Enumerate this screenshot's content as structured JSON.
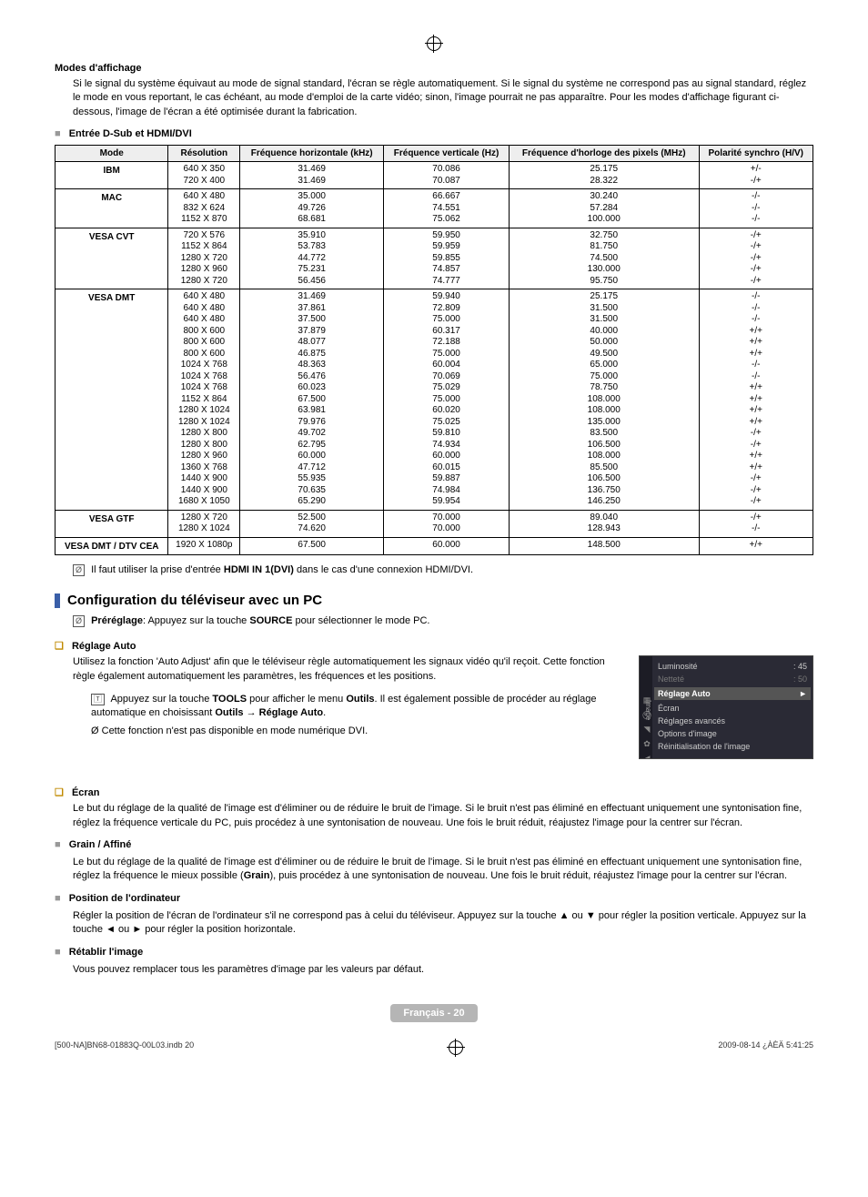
{
  "top": {
    "title": "Modes d'affichage",
    "intro": "Si le signal du système équivaut au mode de signal standard, l'écran se règle automatiquement. Si le signal du système ne correspond pas au signal standard, réglez le mode en vous reportant, le cas échéant, au mode d'emploi de la carte vidéo; sinon, l'image pourrait ne pas apparaître. Pour les modes d'affichage figurant ci-dessous, l'image de l'écran a été optimisée durant la fabrication.",
    "subheading": "Entrée D-Sub et HDMI/DVI"
  },
  "table": {
    "headers": {
      "mode": "Mode",
      "res": "Résolution",
      "hfreq": "Fréquence horizontale (kHz)",
      "vfreq": "Fréquence verticale (Hz)",
      "pfreq": "Fréquence d'horloge des pixels (MHz)",
      "pol": "Polarité synchro (H/V)"
    },
    "rows": [
      {
        "mode": "IBM",
        "res": [
          "640 X 350",
          "720 X 400"
        ],
        "h": [
          "31.469",
          "31.469"
        ],
        "v": [
          "70.086",
          "70.087"
        ],
        "p": [
          "25.175",
          "28.322"
        ],
        "pol": [
          "+/-",
          "-/+"
        ]
      },
      {
        "mode": "MAC",
        "res": [
          "640 X 480",
          "832 X 624",
          "1152 X 870"
        ],
        "h": [
          "35.000",
          "49.726",
          "68.681"
        ],
        "v": [
          "66.667",
          "74.551",
          "75.062"
        ],
        "p": [
          "30.240",
          "57.284",
          "100.000"
        ],
        "pol": [
          "-/-",
          "-/-",
          "-/-"
        ]
      },
      {
        "mode": "VESA CVT",
        "res": [
          "720 X 576",
          "1152 X 864",
          "1280 X 720",
          "1280 X 960",
          "1280 X 720"
        ],
        "h": [
          "35.910",
          "53.783",
          "44.772",
          "75.231",
          "56.456"
        ],
        "v": [
          "59.950",
          "59.959",
          "59.855",
          "74.857",
          "74.777"
        ],
        "p": [
          "32.750",
          "81.750",
          "74.500",
          "130.000",
          "95.750"
        ],
        "pol": [
          "-/+",
          "-/+",
          "-/+",
          "-/+",
          "-/+"
        ]
      },
      {
        "mode": "VESA DMT",
        "res": [
          "640 X 480",
          "640 X 480",
          "640 X 480",
          "800 X 600",
          "800 X 600",
          "800 X 600",
          "1024 X 768",
          "1024 X 768",
          "1024 X 768",
          "1152 X 864",
          "1280 X 1024",
          "1280 X 1024",
          "1280 X 800",
          "1280 X 800",
          "1280 X 960",
          "1360 X 768",
          "1440 X 900",
          "1440 X 900",
          "1680 X 1050"
        ],
        "h": [
          "31.469",
          "37.861",
          "37.500",
          "37.879",
          "48.077",
          "46.875",
          "48.363",
          "56.476",
          "60.023",
          "67.500",
          "63.981",
          "79.976",
          "49.702",
          "62.795",
          "60.000",
          "47.712",
          "55.935",
          "70.635",
          "65.290"
        ],
        "v": [
          "59.940",
          "72.809",
          "75.000",
          "60.317",
          "72.188",
          "75.000",
          "60.004",
          "70.069",
          "75.029",
          "75.000",
          "60.020",
          "75.025",
          "59.810",
          "74.934",
          "60.000",
          "60.015",
          "59.887",
          "74.984",
          "59.954"
        ],
        "p": [
          "25.175",
          "31.500",
          "31.500",
          "40.000",
          "50.000",
          "49.500",
          "65.000",
          "75.000",
          "78.750",
          "108.000",
          "108.000",
          "135.000",
          "83.500",
          "106.500",
          "108.000",
          "85.500",
          "106.500",
          "136.750",
          "146.250"
        ],
        "pol": [
          "-/-",
          "-/-",
          "-/-",
          "+/+",
          "+/+",
          "+/+",
          "-/-",
          "-/-",
          "+/+",
          "+/+",
          "+/+",
          "+/+",
          "-/+",
          "-/+",
          "+/+",
          "+/+",
          "-/+",
          "-/+",
          "-/+"
        ]
      },
      {
        "mode": "VESA GTF",
        "res": [
          "1280 X 720",
          "1280 X 1024"
        ],
        "h": [
          "52.500",
          "74.620"
        ],
        "v": [
          "70.000",
          "70.000"
        ],
        "p": [
          "89.040",
          "128.943"
        ],
        "pol": [
          "-/+",
          "-/-"
        ]
      },
      {
        "mode": "VESA DMT / DTV CEA",
        "res": [
          "1920 X 1080p"
        ],
        "h": [
          "67.500"
        ],
        "v": [
          "60.000"
        ],
        "p": [
          "148.500"
        ],
        "pol": [
          "+/+"
        ]
      }
    ]
  },
  "hdmi_note_pre": "Il faut utiliser la prise d'entrée ",
  "hdmi_note_bold": "HDMI IN 1(DVI)",
  "hdmi_note_post": " dans le cas d'une connexion HDMI/DVI.",
  "config_h2": "Configuration du téléviseur avec un PC",
  "prereg_bold": "Préréglage",
  "prereg_mid": ": Appuyez sur la touche ",
  "prereg_src": "SOURCE",
  "prereg_end": " pour sélectionner le mode PC.",
  "reglage_auto": {
    "title": "Réglage Auto",
    "para": "Utilisez la fonction 'Auto Adjust' afin que le téléviseur règle automatiquement les signaux vidéo qu'il reçoit. Cette fonction règle également automatiquement les paramètres, les fréquences et les positions.",
    "tools_pre": "Appuyez sur la touche ",
    "tools_b": "TOOLS",
    "tools_mid": " pour afficher le menu ",
    "tools_b2": "Outils",
    "tools_mid2": ". Il est également possible de procéder au réglage automatique en choisissant ",
    "tools_b3": "Outils → Réglage Auto",
    "tools_end": ".",
    "not_avail": "Cette fonction n'est pas disponible en mode numérique DVI."
  },
  "panel": {
    "tab": "Image",
    "r1": "Luminosité",
    "r1v": ": 45",
    "r2": "Netteté",
    "r2v": ": 50",
    "hl": "Réglage Auto",
    "r4": "Écran",
    "r5": "Réglages avancés",
    "r6": "Options d'image",
    "r7": "Réinitialisation de l'image"
  },
  "ecran": {
    "title": "Écran",
    "intro": "Le but du réglage de la qualité de l'image est d'éliminer ou de réduire le bruit de l'image. Si le bruit n'est pas éliminé en effectuant uniquement une syntonisation fine, réglez la fréquence verticale du PC, puis procédez à une syntonisation de nouveau. Une fois le bruit réduit, réajustez l'image pour la centrer sur l'écran.",
    "grain_h": "Grain / Affiné",
    "grain_p_pre": "Le but du réglage de la qualité de l'image est d'éliminer ou de réduire le bruit de l'image. Si le bruit n'est pas éliminé en effectuant uniquement une syntonisation fine, réglez la fréquence le mieux possible (",
    "grain_p_b": "Grain",
    "grain_p_post": "), puis procédez à une syntonisation de nouveau. Une fois le bruit réduit, réajustez l'image pour la centrer sur l'écran.",
    "pos_h": "Position de l'ordinateur",
    "pos_p": "Régler la position de l'écran de l'ordinateur s'il ne correspond pas à celui du téléviseur. Appuyez sur la touche ▲ ou ▼ pour régler la position verticale. Appuyez sur la touche ◄ ou ► pour régler la position horizontale.",
    "ret_h": "Rétablir l'image",
    "ret_p": "Vous pouvez remplacer tous les paramètres d'image par les valeurs par défaut."
  },
  "footer": {
    "page": "Français - 20",
    "left": "[500-NA]BN68-01883Q-00L03.indb   20",
    "right": "2009-08-14   ¿ÀÈÄ 5:41:25"
  }
}
